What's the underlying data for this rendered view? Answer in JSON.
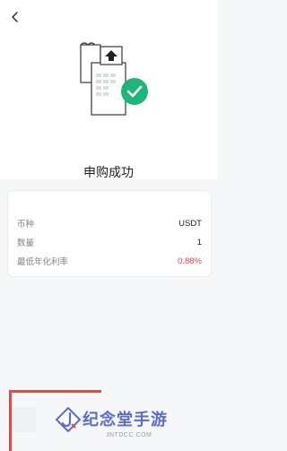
{
  "header": {
    "back_icon": "chevron-left-icon"
  },
  "hero": {
    "illustration_icon": "receipt-upload-success-icon",
    "accent": "#1fb57a"
  },
  "title": "申购成功",
  "details": [
    {
      "label": "币种",
      "value": "USDT"
    },
    {
      "label": "数量",
      "value": "1"
    },
    {
      "label": "最低年化利率",
      "value": "0.88%"
    }
  ],
  "colors": {
    "rate": "#e2434f",
    "brand": "#5c6bcf",
    "bracket": "#e24a43"
  },
  "watermark": {
    "brand": "纪念堂手游",
    "domain": "JNTDCC.COM"
  }
}
